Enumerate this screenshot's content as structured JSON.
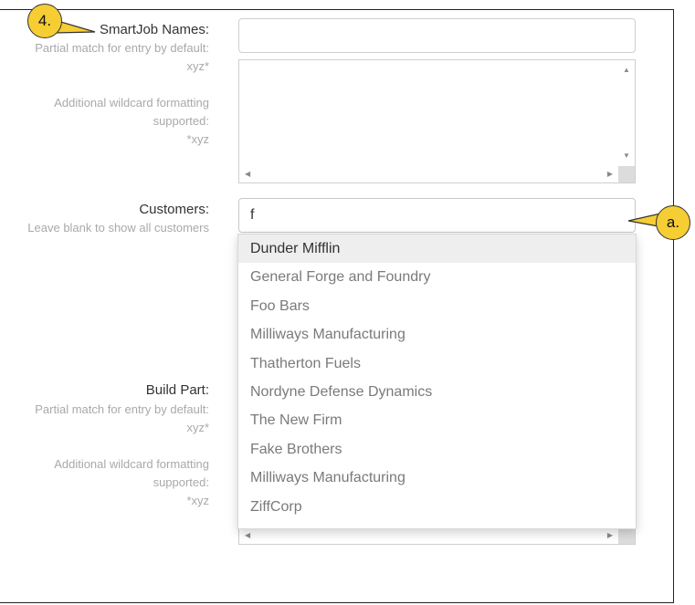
{
  "smartjob": {
    "label": "SmartJob Names:",
    "hint_line1": "Partial match for entry by default:",
    "hint_line2": "xyz*",
    "hint_line3": "Additional wildcard formatting",
    "hint_line4": "supported:",
    "hint_line5": "*xyz",
    "input_value": ""
  },
  "customers": {
    "label": "Customers:",
    "hint": "Leave blank to show all customers",
    "input_value": "f",
    "options": [
      "Dunder Mifflin",
      "General Forge and Foundry",
      "Foo Bars",
      "Milliways Manufacturing",
      "Thatherton Fuels",
      "Nordyne Defense Dynamics",
      "The New Firm",
      "Fake Brothers",
      "Milliways Manufacturing",
      "ZiffCorp"
    ],
    "highlighted_index": 0
  },
  "build_part": {
    "label": "Build Part:",
    "hint_line1": "Partial match for entry by default:",
    "hint_line2": "xyz*",
    "hint_line3": "Additional wildcard formatting",
    "hint_line4": "supported:",
    "hint_line5": "*xyz"
  },
  "callouts": {
    "step": "4.",
    "sub": "a."
  },
  "colors": {
    "callout_fill": "#f6cd33",
    "hint_text": "#a9a9a9",
    "option_text": "#7a7a7a",
    "highlight_bg": "#eeeeee"
  }
}
